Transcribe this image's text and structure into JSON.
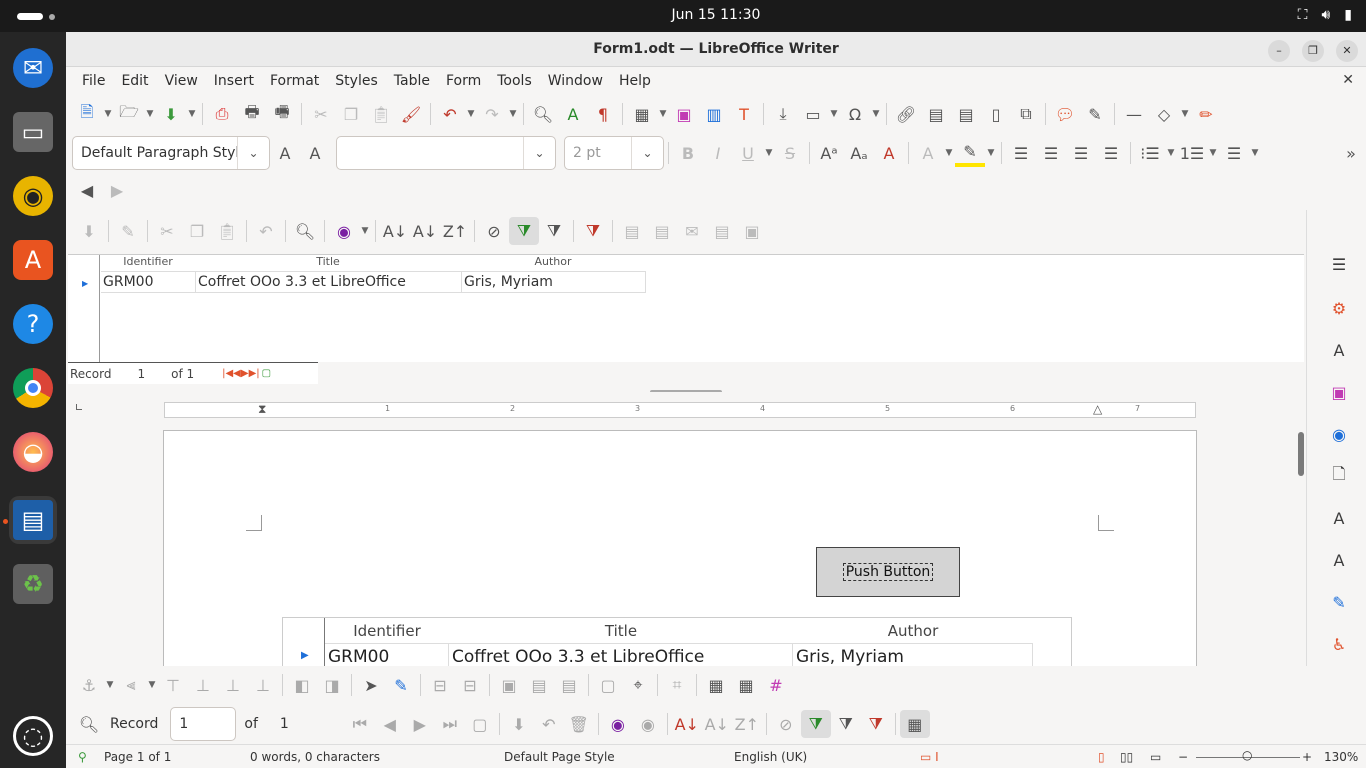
{
  "topbar": {
    "clock": "Jun 15  11:30"
  },
  "dock": {
    "apps": [
      "thunderbird-icon",
      "files-icon",
      "rhythmbox-icon",
      "app-center-icon",
      "help-icon",
      "chrome-icon",
      "firefox-icon",
      "writer-icon",
      "trash-icon",
      "ubuntu-icon"
    ]
  },
  "window": {
    "title": "Form1.odt — LibreOffice Writer"
  },
  "menu": [
    "File",
    "Edit",
    "View",
    "Insert",
    "Format",
    "Styles",
    "Table",
    "Form",
    "Tools",
    "Window",
    "Help"
  ],
  "formatting": {
    "paragraph_style": "Default Paragraph Styl",
    "font_name": "",
    "font_size": "2 pt"
  },
  "datasource": {
    "columns": [
      "Identifier",
      "Title",
      "Author"
    ],
    "row": [
      "GRM00",
      "Coffret OOo 3.3 et LibreOffice",
      "Gris, Myriam"
    ],
    "nav_label": "Record",
    "nav_current": "1",
    "nav_of": "of 1"
  },
  "document": {
    "push_button_label": "Push Button",
    "columns": [
      "Identifier",
      "Title",
      "Author"
    ],
    "row": [
      "GRM00",
      "Coffret OOo 3.3 et LibreOffice",
      "Gris, Myriam"
    ],
    "ruler_numbers": [
      "1",
      "2",
      "3",
      "4",
      "5",
      "6",
      "7"
    ]
  },
  "form_navigation": {
    "record_label": "Record",
    "record_value": "1",
    "of_label": "of",
    "total": "1"
  },
  "status": {
    "page": "Page 1 of 1",
    "words": "0 words, 0 characters",
    "page_style": "Default Page Style",
    "language": "English (UK)",
    "zoom": "130%"
  }
}
